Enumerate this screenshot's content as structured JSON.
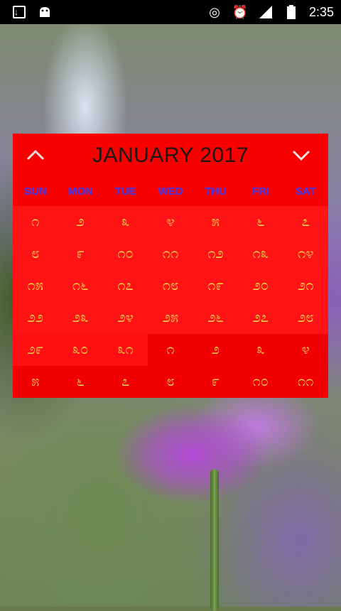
{
  "statusbar": {
    "time": "2:35",
    "icons_left": [
      "download-icon",
      "android-icon"
    ],
    "icons_right": [
      "hotspot-icon",
      "alarm-icon",
      "signal-icon",
      "battery-icon"
    ]
  },
  "calendar": {
    "title": "JANUARY 2017",
    "prev_icon": "^",
    "next_icon": "⌄",
    "weekdays": [
      "SUN",
      "MON",
      "TUE",
      "WED",
      "THU",
      "FRI",
      "SAT"
    ],
    "weeks": [
      [
        "೧",
        "೨",
        "೩",
        "೪",
        "೫",
        "೬",
        "೭"
      ],
      [
        "೮",
        "೯",
        "೧೦",
        "೧೧",
        "೧೨",
        "೧೩",
        "೧೪"
      ],
      [
        "೧೫",
        "೧೬",
        "೧೭",
        "೧೮",
        "೧೯",
        "೨೦",
        "೨೧"
      ],
      [
        "೨೨",
        "೨೩",
        "೨೪",
        "೨೫",
        "೨೬",
        "೨೭",
        "೨೮"
      ],
      [
        "೨೯",
        "೩೦",
        "೩೧",
        "೧",
        "೨",
        "೩",
        "೪"
      ],
      [
        "೫",
        "೬",
        "೭",
        "೮",
        "೯",
        "೧೦",
        "೧೧"
      ]
    ],
    "colors": {
      "background": "#f70000",
      "title": "#1c1616",
      "weekday": "#4b2fd0",
      "day": "#f0e050"
    }
  }
}
